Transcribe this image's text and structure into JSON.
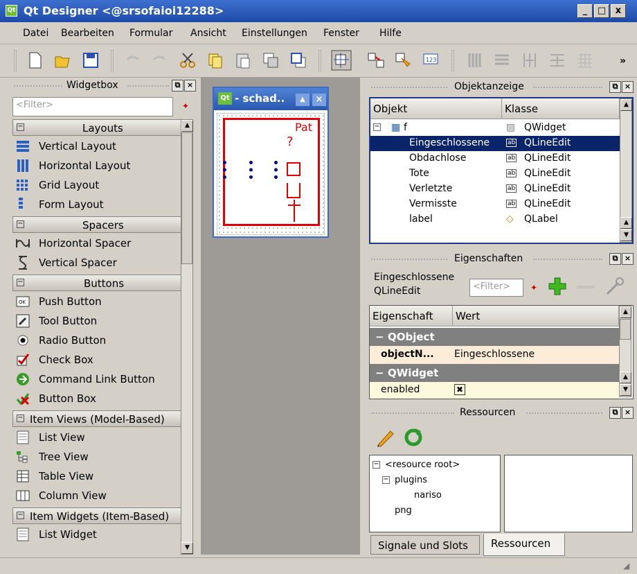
{
  "window": {
    "title": "Qt Designer <@srsofaioi12288>",
    "min": "_",
    "max": "□",
    "close": "x"
  },
  "menu": [
    "Datei",
    "Bearbeiten",
    "Formular",
    "Ansicht",
    "Einstellungen",
    "Fenster",
    "Hilfe"
  ],
  "toolbar": {
    "more": "»"
  },
  "widgetbox": {
    "title": "Widgetbox",
    "filter_placeholder": "<Filter>",
    "categories": [
      {
        "label": "Layouts",
        "items": [
          "Vertical Layout",
          "Horizontal Layout",
          "Grid Layout",
          "Form Layout"
        ]
      },
      {
        "label": "Spacers",
        "items": [
          "Horizontal Spacer",
          "Vertical Spacer"
        ]
      },
      {
        "label": "Buttons",
        "items": [
          "Push Button",
          "Tool Button",
          "Radio Button",
          "Check Box",
          "Command Link Button",
          "Button Box"
        ]
      },
      {
        "label": "Item Views (Model-Based)",
        "items": [
          "List View",
          "Tree View",
          "Table View",
          "Column View"
        ]
      },
      {
        "label": "Item Widgets (Item-Based)",
        "items": [
          "List Widget"
        ]
      }
    ]
  },
  "subwindow": {
    "title": "- schad..",
    "form_labels": {
      "pat": "Pat",
      "q": "?"
    }
  },
  "objektanzeige": {
    "title": "Objektanzeige",
    "headers": [
      "Objekt",
      "Klasse"
    ],
    "rows": [
      {
        "name": "f",
        "class": "QWidget"
      },
      {
        "name": "Eingeschlossene",
        "class": "QLineEdit",
        "selected": true
      },
      {
        "name": "Obdachlose",
        "class": "QLineEdit"
      },
      {
        "name": "Tote",
        "class": "QLineEdit"
      },
      {
        "name": "Verletzte",
        "class": "QLineEdit"
      },
      {
        "name": "Vermisste",
        "class": "QLineEdit"
      },
      {
        "name": "label",
        "class": "QLabel"
      }
    ]
  },
  "eigenschaften": {
    "title": "Eigenschaften",
    "object_name": "Eingeschlossene",
    "object_class": "QLineEdit",
    "filter_placeholder": "<Filter>",
    "headers": [
      "Eigenschaft",
      "Wert"
    ],
    "groups": [
      {
        "label": "QObject",
        "props": [
          {
            "name": "objectN...",
            "value": "Eingeschlossene"
          }
        ]
      },
      {
        "label": "QWidget",
        "props": [
          {
            "name": "enabled",
            "value": "✖"
          }
        ]
      }
    ]
  },
  "ressourcen": {
    "title": "Ressourcen",
    "tree": [
      "<resource root>",
      "plugins",
      "nariso",
      "png"
    ]
  },
  "tabs": [
    "Signale und Slots",
    "Ressourcen"
  ],
  "colors": {
    "selection": "#0a246a",
    "title_blue": "#2a58b0",
    "form_red": "#e00000",
    "group_gray": "#808080"
  }
}
